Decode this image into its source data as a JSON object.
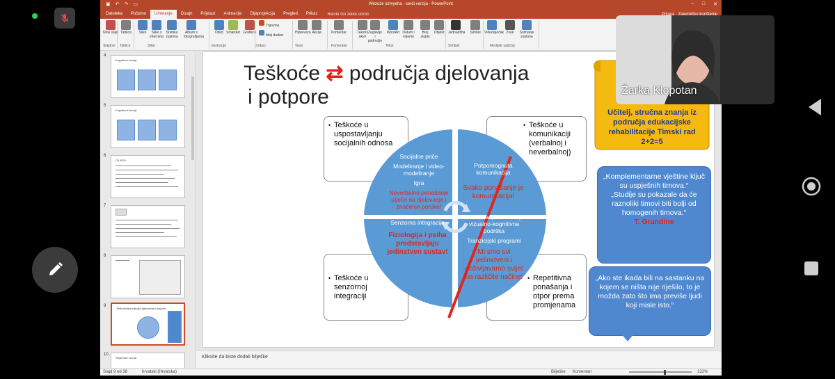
{
  "call": {
    "participant_name": "Žarka Klopotan"
  },
  "window": {
    "title": "Wezoze ozmyeha - serdi verzija - PowerPoint",
    "account": "Prijava",
    "share": "Zajedničko korištenje",
    "tell_me": "Recite što želite učiniti"
  },
  "tabs": [
    "Datoteka",
    "Početno",
    "Umetanje",
    "Dizajn",
    "Prijelazi",
    "Animacije",
    "Dijaprojekcija",
    "Pregled",
    "Prikaz"
  ],
  "active_tab": "Umetanje",
  "ribbon": {
    "buttons": [
      {
        "label": "Novi slajd"
      },
      {
        "label": "Tablica"
      },
      {
        "label": "Slike"
      },
      {
        "label": "Slike s interneta"
      },
      {
        "label": "Snimka zaslona"
      },
      {
        "label": "Album s fotografijama"
      },
      {
        "label": "Oblici"
      },
      {
        "label": "SmartArt"
      },
      {
        "label": "Grafikon"
      },
      {
        "label": "Trgovina"
      },
      {
        "label": "Moji dodaci"
      },
      {
        "label": "Hiperveza"
      },
      {
        "label": "Akcija"
      },
      {
        "label": "Komentar"
      },
      {
        "label": "Tekstni okvir"
      },
      {
        "label": "Zaglavlje i podnožje"
      },
      {
        "label": "WordArt"
      },
      {
        "label": "Datum i vrijeme"
      },
      {
        "label": "Broj slajda"
      },
      {
        "label": "Objekt"
      },
      {
        "label": "Jednadžba"
      },
      {
        "label": "Simbol"
      },
      {
        "label": "Videoisječak"
      },
      {
        "label": "Zvuk"
      },
      {
        "label": "Snimanje zaslona"
      }
    ],
    "groups": [
      "Slajdovi",
      "Tablice",
      "Slike",
      "Ilustracije",
      "Dodaci",
      "Veze",
      "Komentari",
      "Tekst",
      "Simboli",
      "Medijski sadržaj"
    ]
  },
  "thumbnails": {
    "numbers": [
      "4",
      "5",
      "6",
      "7",
      "8",
      "9",
      "10"
    ],
    "titles": [
      "Kognitivne teorije",
      "Kognitivne teorije",
      "CILJEVI",
      "",
      "",
      "Teškoće ⇄ područja djelovanja i potpore",
      "Smjernice za rad"
    ]
  },
  "slide": {
    "title_part1": "Teškoće",
    "title_arrows": "⇄",
    "title_part2": "područja djelovanja",
    "title_line2": "i potpore",
    "box_tl": "Teškoće u uspostavljanju socijalnih odnosa",
    "box_tr": "Teškoće u komunikaciji (verbalnoj i neverbalnoj)",
    "box_bl": "Teškoće u senzornoj integraciji",
    "box_br": "Repetitivna ponašanja i otpor prema promjenama",
    "q1_line1": "Socijalne priče",
    "q1_line2": "Modeliranje i video-modeliranje",
    "q1_line3": "Igra",
    "q1_red": "Neverbalno ponašanje utječe na djelovanje i značenje poruke!",
    "q2_line1": "Potpomognuta komunikacija",
    "q2_red": "Svako ponašanje je komunikacija!",
    "q3_line1": "Senzorna integracija",
    "q3_red": "Fiziologija i psiha predstavljaju jedinstven sustav!",
    "q4_line1": "Strukturiranje okruženja i vizualno-kognitivna podrška",
    "q4_line2": "Tranzicijski programi",
    "q4_red": "Mi smo svi jedinstveni i doživljavamo svijet na različite načine!",
    "yellow_text": "Učitelj, stručna znanja iz područja edukacijske rehabilitacije Timski rad 2+2=5",
    "blue1_line1": "„Komplementarne vještine ključ su uspješnih timova.“",
    "blue1_line2": "„Studije su pokazale da će raznoliki timovi biti bolji od homogenih timova.“",
    "blue1_author": "T. Grandine",
    "blue2": "„Ako ste ikada bili na sastanku na kojem se ništa nije riješilo, to je možda zato što ima previše ljudi koji misle isto.“"
  },
  "notes_placeholder": "Kliknite da biste dodali bilješke",
  "status": {
    "slide_of": "Slajd 9 od 38",
    "language": "hrvatski (Hrvatska)",
    "notes": "Bilješke",
    "comments": "Komentari",
    "zoom": "122%"
  },
  "colors": {
    "ppt_accent": "#b7472a",
    "circle_blue": "#5b9bd5",
    "red_text": "#e0251b",
    "yellow": "#f5b90f",
    "quote_blue": "#4f88cf"
  }
}
